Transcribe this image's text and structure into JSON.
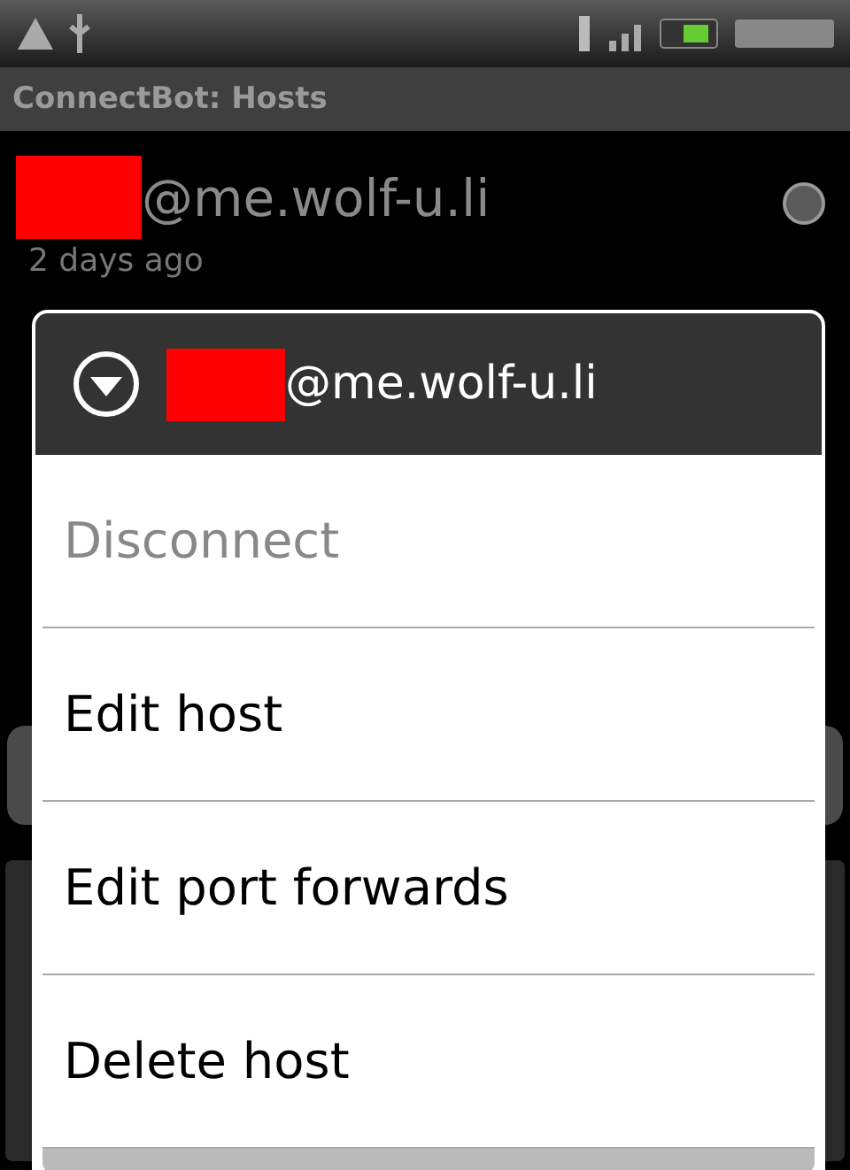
{
  "window": {
    "title": "ConnectBot: Hosts"
  },
  "hosts": [
    {
      "host": "@me.wolf-u.li",
      "last_connect": "2 days ago",
      "connected": false
    }
  ],
  "context_menu": {
    "title": "@me.wolf-u.li",
    "items": [
      {
        "label": "Disconnect",
        "disabled": true
      },
      {
        "label": "Edit host",
        "disabled": false
      },
      {
        "label": "Edit port forwards",
        "disabled": false
      },
      {
        "label": "Delete host",
        "disabled": false
      }
    ]
  }
}
